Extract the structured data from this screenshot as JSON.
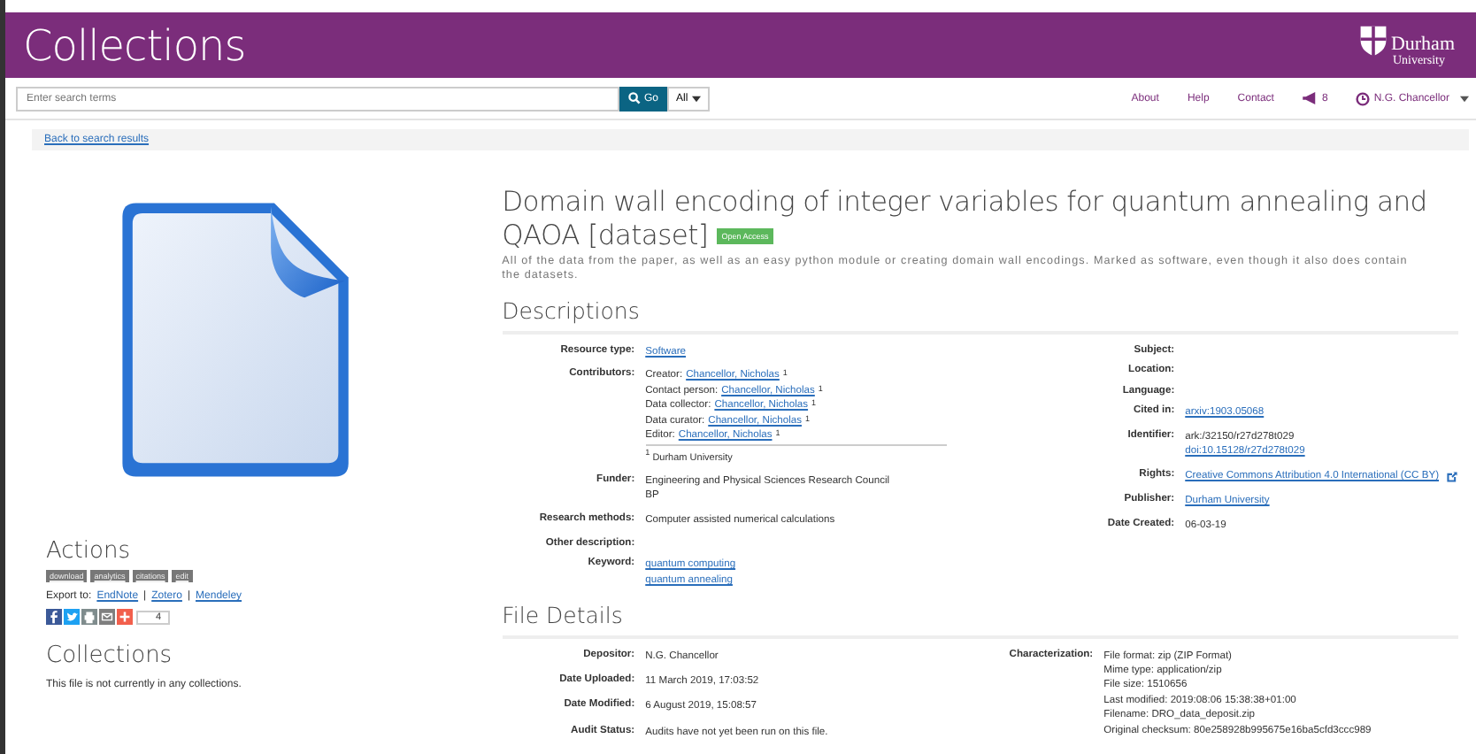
{
  "header": {
    "title": "Collections",
    "logo": {
      "name": "Durham",
      "sub": "University"
    }
  },
  "navbar": {
    "search": {
      "placeholder": "Enter search terms"
    },
    "go": "Go",
    "scope": "All",
    "links": [
      {
        "label": "About"
      },
      {
        "label": "Help"
      },
      {
        "label": "Contact"
      }
    ],
    "notifications": "8",
    "user": "N.G. Chancellor"
  },
  "breadcrumb": "Back to search results",
  "sidebar": {
    "actions_title": "Actions",
    "action_buttons": [
      "download",
      "analytics",
      "citations",
      "edit"
    ],
    "export_label": "Export to:",
    "export_separator": "|",
    "export_links": [
      "EndNote",
      "Zotero",
      "Mendeley"
    ],
    "share": [
      {
        "kind": "facebook",
        "color": "#3b5998"
      },
      {
        "kind": "twitter",
        "color": "#1da1f2"
      },
      {
        "kind": "print",
        "color": "#7f8c8d"
      },
      {
        "kind": "email",
        "color": "#7f7f7f"
      },
      {
        "kind": "plus",
        "color": "#f25f4c"
      }
    ],
    "share_count": "4",
    "collections_title": "Collections",
    "collections_text": "This file is not currently in any collections."
  },
  "record": {
    "title": "Domain wall encoding of integer variables for quantum annealing and QAOA [dataset]",
    "badge": "Open Access",
    "description": "All of the data from the paper, as well as an easy python module or creating domain wall encodings. Marked as software, even though it also does contain the datasets.",
    "descriptions_title": "Descriptions",
    "left_fields": [
      {
        "label": "Resource type:",
        "kind": "lines",
        "values": [
          {
            "text": "Software",
            "link": true
          }
        ]
      },
      {
        "label": "Contributors:",
        "kind": "contributors",
        "values": [
          {
            "role": "Creator:",
            "name": "Chancellor, Nicholas",
            "note": "1"
          },
          {
            "role": "Contact person:",
            "name": "Chancellor, Nicholas",
            "note": "1"
          },
          {
            "role": "Data collector:",
            "name": "Chancellor, Nicholas",
            "note": "1"
          },
          {
            "role": "Data curator:",
            "name": "Chancellor, Nicholas",
            "note": "1"
          },
          {
            "role": "Editor:",
            "name": "Chancellor, Nicholas",
            "note": "1"
          }
        ],
        "footnote": "$^{1}$ Durham University"
      },
      {
        "label": "Funder:",
        "kind": "lines",
        "values": [
          {
            "text": "Engineering and Physical Sciences Research Council",
            "link": false
          },
          {
            "text": "BP",
            "link": false
          }
        ]
      },
      {
        "label": "Research methods:",
        "kind": "lines",
        "values": [
          {
            "text": "Computer assisted numerical calculations",
            "link": false
          }
        ]
      },
      {
        "label": "Other description:",
        "kind": "lines"
      },
      {
        "label": "Keyword:",
        "kind": "lines",
        "values": [
          {
            "text": "quantum computing",
            "link": true
          },
          {
            "text": "quantum annealing",
            "link": true
          }
        ]
      }
    ],
    "right_fields": [
      {
        "label": "Subject:",
        "kind": "lines"
      },
      {
        "label": "Location:",
        "kind": "lines"
      },
      {
        "label": "Language:",
        "kind": "lines"
      },
      {
        "label": "Cited in:",
        "kind": "lines",
        "values": [
          {
            "text": "arxiv:1903.05068",
            "link": true
          }
        ]
      },
      {
        "label": "Identifier:",
        "kind": "lines",
        "values": [
          {
            "text": "ark:/32150/r27d278t029",
            "link": false
          },
          {
            "text": "doi:10.15128/r27d278t029",
            "link": true
          }
        ]
      },
      {
        "label": "Rights:",
        "kind": "lines",
        "values": [
          {
            "text": "Creative Commons Attribution 4.0 International (CC BY)",
            "link": true,
            "external": true
          }
        ]
      },
      {
        "label": "Publisher:",
        "kind": "lines",
        "values": [
          {
            "text": "Durham University",
            "link": true
          }
        ]
      },
      {
        "label": "Date Created:",
        "kind": "lines",
        "values": [
          {
            "text": "06-03-19",
            "link": false
          }
        ]
      }
    ],
    "file_details_title": "File Details",
    "file_left": [
      {
        "label": "Depositor:",
        "values": [
          "N.G. Chancellor"
        ]
      },
      {
        "label": "Date Uploaded:",
        "values": [
          "11 March 2019, 17:03:52"
        ]
      },
      {
        "label": "Date Modified:",
        "values": [
          "6 August 2019, 15:08:57"
        ]
      },
      {
        "label": "Audit Status:",
        "values": [
          "Audits have not yet been run on this file."
        ]
      }
    ],
    "file_right": [
      {
        "label": "Characterization:",
        "values": [
          "File format: zip (ZIP Format)",
          "Mime type: application/zip",
          "File size: 1510656",
          "Last modified: 2019:08:06 15:38:38+01:00",
          "Filename: DRO_data_deposit.zip",
          "Original checksum: 80e258928b995675e16ba5cfd3ccc989"
        ]
      }
    ]
  }
}
